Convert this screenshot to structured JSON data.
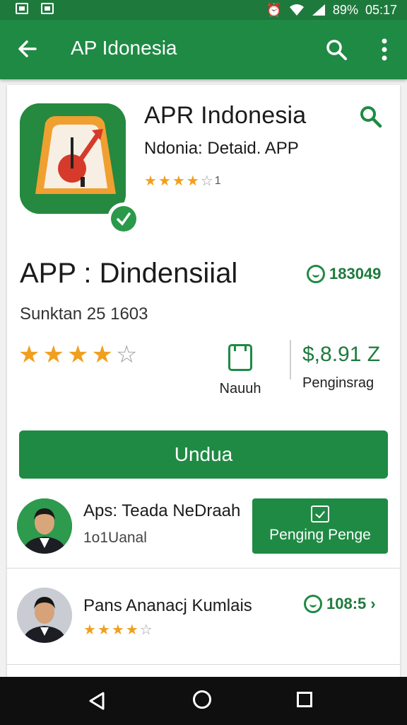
{
  "status_bar": {
    "battery": "89%",
    "time": "05:17"
  },
  "app_bar": {
    "title": "AP Idonesia",
    "icons": [
      "back-arrow-icon",
      "search-icon",
      "more-vert-icon"
    ]
  },
  "header": {
    "title": "APR Indonesia",
    "subtitle": "Ndonia: Detaid. APP",
    "rating_stars": 4,
    "rating_count": "1"
  },
  "detail": {
    "title": "APP : Dindensiial",
    "badge_value": "183049",
    "sub_info": "Sunktan 25 1603",
    "rating_stars": 4,
    "stat_mid_label": "Nauuh",
    "stat_right_value": "$,8.91 Z",
    "stat_right_label": "Penginsrag"
  },
  "install_button": {
    "label": "Undua"
  },
  "reviews": [
    {
      "title": "Aps: Teada NeDraah",
      "subtitle": "1o1Uanal",
      "button_label": "Penging Penge"
    },
    {
      "title": "Pans Ananacj Kumlais",
      "rating_stars": 4,
      "badge_value": "108:5"
    }
  ],
  "colors": {
    "primary": "#1f8a44",
    "star": "#f0a01e",
    "navbar": "#0f0f0f"
  }
}
